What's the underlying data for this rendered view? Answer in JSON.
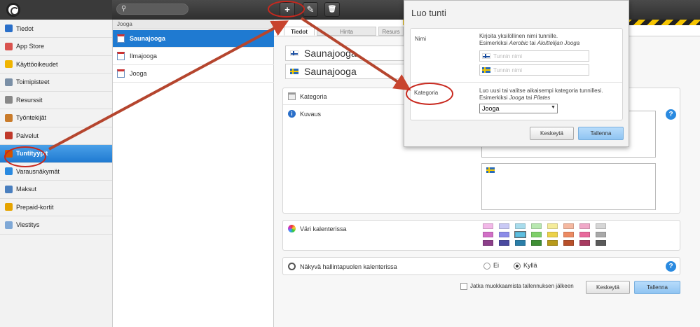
{
  "sidebar": {
    "items": [
      {
        "label": "Tiedot",
        "icon": "info-icon",
        "color": "#2a6fc9"
      },
      {
        "label": "App Store",
        "icon": "app-store-icon",
        "color": "#d9534f"
      },
      {
        "label": "Käyttöoikeudet",
        "icon": "star-icon",
        "color": "#f0b400"
      },
      {
        "label": "Toimipisteet",
        "icon": "building-icon",
        "color": "#7a8fa6"
      },
      {
        "label": "Resurssit",
        "icon": "resources-icon",
        "color": "#888888"
      },
      {
        "label": "Työntekijät",
        "icon": "people-icon",
        "color": "#c97b2a"
      },
      {
        "label": "Palvelut",
        "icon": "services-icon",
        "color": "#c0392b"
      },
      {
        "label": "Tuntityypit",
        "icon": "calendar-icon",
        "color": "#d35400"
      },
      {
        "label": "Varausnäkymät",
        "icon": "globe-icon",
        "color": "#2a8ae0"
      },
      {
        "label": "Maksut",
        "icon": "payment-icon",
        "color": "#4a7fbf"
      },
      {
        "label": "Prepaid-kortit",
        "icon": "card-icon",
        "color": "#e6a400"
      },
      {
        "label": "Viestitys",
        "icon": "message-icon",
        "color": "#7fa8d6"
      }
    ],
    "active_index": 7
  },
  "list": {
    "header": "Jooga",
    "items": [
      "Saunajooga",
      "Ilmajooga",
      "Jooga"
    ],
    "active_index": 0
  },
  "toolbar": {
    "add": "+",
    "edit": "✎",
    "delete": "🗑"
  },
  "tabs": [
    "Tiedot",
    "Hinta",
    "Resurs"
  ],
  "form": {
    "name_fi": "Saunajooga",
    "name_se": "Saunajooga",
    "kategoria_label": "Kategoria",
    "kuvaus_label": "Kuvaus",
    "vari_label": "Väri kalenterissa",
    "nakyva_label": "Näkyvä hallintapuolen kalenterissa",
    "radio_no": "Ei",
    "radio_yes": "Kyllä",
    "continue_label": "Jatka muokkaamista tallennuksen jälkeen",
    "cancel": "Keskeytä",
    "save": "Tallenna",
    "help": "?"
  },
  "swatches": [
    [
      "#f2b8e8",
      "#c9c9f5",
      "#a8dcec",
      "#b8e8b0",
      "#f5ec9a",
      "#f5b8a0",
      "#f0a8c8",
      "#d6d6d6"
    ],
    [
      "#d16fc6",
      "#8c8ce8",
      "#5fbfe0",
      "#7fcf6a",
      "#ecd24a",
      "#ec8a62",
      "#e86a9c",
      "#a8a8a8"
    ],
    [
      "#8c3f8a",
      "#4a4aa0",
      "#2a7ea8",
      "#3f8f35",
      "#b89a1a",
      "#b8502a",
      "#a83a60",
      "#5a5a5a"
    ]
  ],
  "dialog": {
    "title": "Luo tunti",
    "nimi_label": "Nimi",
    "nimi_help1": "Kirjoita yksilöllinen nimi tunnille.",
    "nimi_help2_prefix": "Esimerkiksi ",
    "nimi_help2_ex1": "Aerobic",
    "nimi_help2_mid": " tai ",
    "nimi_help2_ex2": "Aloittelijan Jooga",
    "placeholder": "Tunnin nimi",
    "kategoria_label": "Kategoria",
    "kat_help1": "Luo uusi tai valitse aikaisempi kategoria tunnillesi.",
    "kat_help2_prefix": "Esimerkiksi ",
    "kat_help2_ex1": "Jooga",
    "kat_help2_mid": " tai ",
    "kat_help2_ex2": "Pilates",
    "select_value": "Jooga",
    "cancel": "Keskeytä",
    "save": "Tallenna"
  }
}
